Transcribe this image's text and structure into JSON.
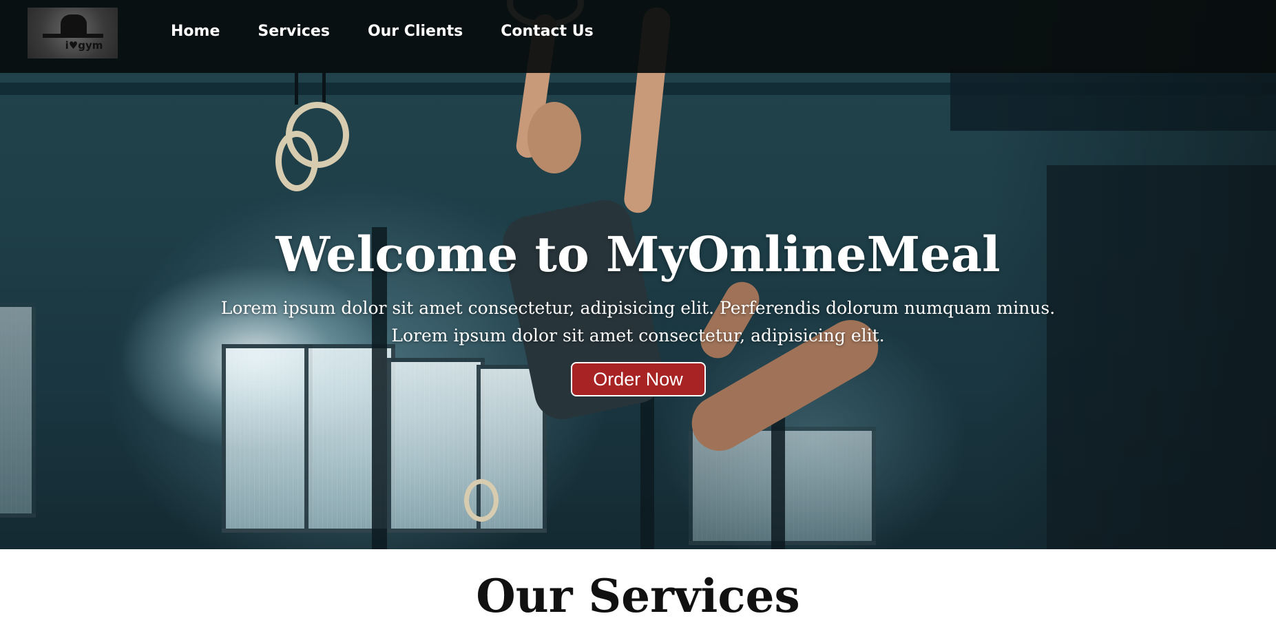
{
  "nav": {
    "logo_text": "i♥gym",
    "links": [
      "Home",
      "Services",
      "Our Clients",
      "Contact Us"
    ]
  },
  "hero": {
    "title": "Welcome to MyOnlineMeal",
    "description_line1": "Lorem ipsum dolor sit amet consectetur, adipisicing elit. Perferendis dolorum numquam minus.",
    "description_line2": "Lorem ipsum dolor sit amet consectetur, adipisicing elit.",
    "cta_label": "Order Now"
  },
  "services": {
    "heading": "Our Services"
  },
  "colors": {
    "nav_bg": "#080c0c",
    "cta_bg": "#a82424",
    "heading_text": "#111111",
    "hero_text": "#ffffff"
  }
}
